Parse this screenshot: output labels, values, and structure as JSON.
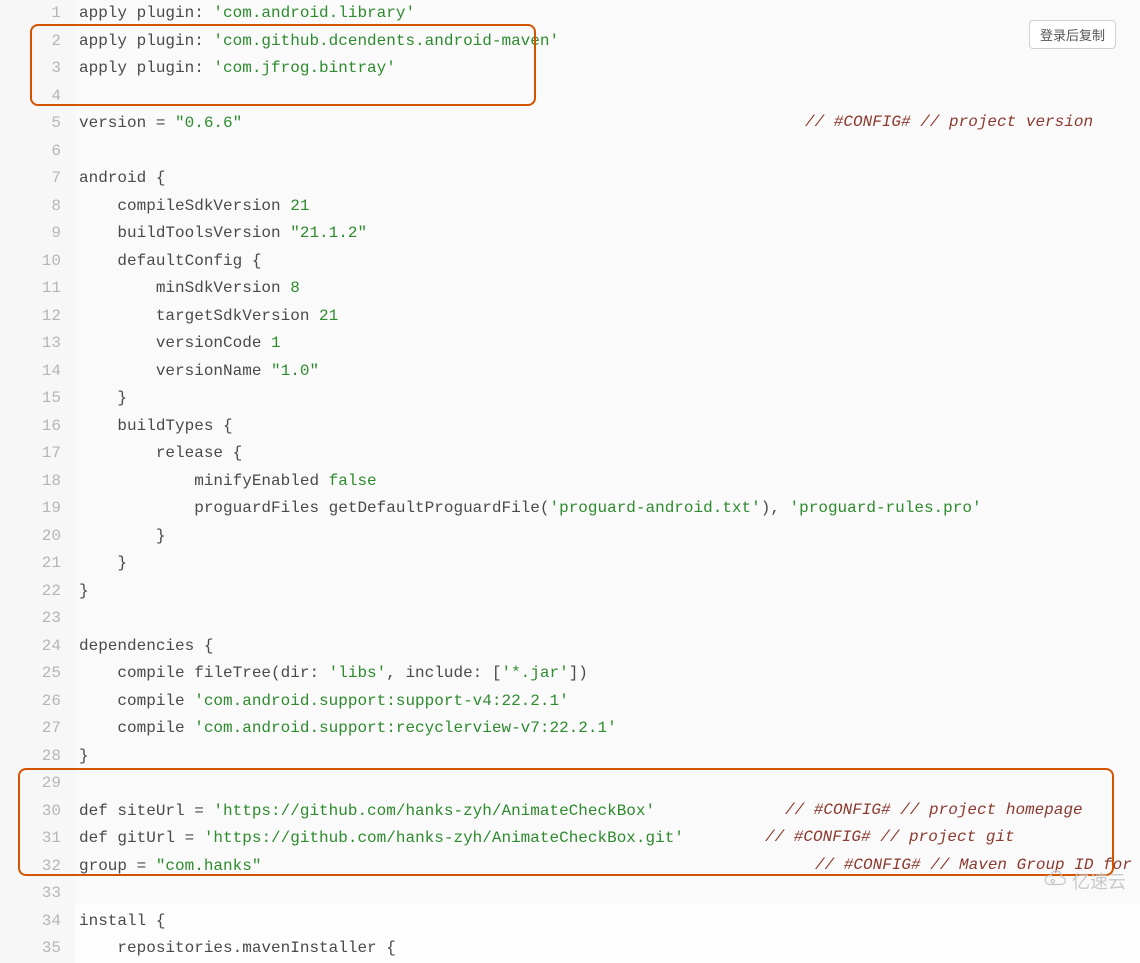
{
  "copy_button_label": "登录后复制",
  "watermark_text": "亿速云",
  "lines": [
    {
      "n": 1,
      "segs": [
        {
          "t": "apply plugin: "
        },
        {
          "t": "'com.android.library'",
          "c": "tok-str"
        }
      ]
    },
    {
      "n": 2,
      "segs": [
        {
          "t": "apply plugin: "
        },
        {
          "t": "'com.github.dcendents.android-maven'",
          "c": "tok-str"
        }
      ]
    },
    {
      "n": 3,
      "segs": [
        {
          "t": "apply plugin: "
        },
        {
          "t": "'com.jfrog.bintray'",
          "c": "tok-str"
        }
      ]
    },
    {
      "n": 4,
      "segs": [
        {
          "t": ""
        }
      ]
    },
    {
      "n": 5,
      "segs": [
        {
          "t": "version = "
        },
        {
          "t": "\"0.6.6\"",
          "c": "tok-str"
        }
      ],
      "right": "// #CONFIG# // project version"
    },
    {
      "n": 6,
      "segs": [
        {
          "t": ""
        }
      ]
    },
    {
      "n": 7,
      "segs": [
        {
          "t": "android {"
        }
      ]
    },
    {
      "n": 8,
      "segs": [
        {
          "t": "    compileSdkVersion "
        },
        {
          "t": "21",
          "c": "tok-num"
        }
      ]
    },
    {
      "n": 9,
      "segs": [
        {
          "t": "    buildToolsVersion "
        },
        {
          "t": "\"21.1.2\"",
          "c": "tok-str"
        }
      ]
    },
    {
      "n": 10,
      "segs": [
        {
          "t": "    defaultConfig {"
        }
      ]
    },
    {
      "n": 11,
      "segs": [
        {
          "t": "        minSdkVersion "
        },
        {
          "t": "8",
          "c": "tok-num"
        }
      ]
    },
    {
      "n": 12,
      "segs": [
        {
          "t": "        targetSdkVersion "
        },
        {
          "t": "21",
          "c": "tok-num"
        }
      ]
    },
    {
      "n": 13,
      "segs": [
        {
          "t": "        versionCode "
        },
        {
          "t": "1",
          "c": "tok-num"
        }
      ]
    },
    {
      "n": 14,
      "segs": [
        {
          "t": "        versionName "
        },
        {
          "t": "\"1.0\"",
          "c": "tok-str"
        }
      ]
    },
    {
      "n": 15,
      "segs": [
        {
          "t": "    }"
        }
      ]
    },
    {
      "n": 16,
      "segs": [
        {
          "t": "    buildTypes {"
        }
      ]
    },
    {
      "n": 17,
      "segs": [
        {
          "t": "        release {"
        }
      ]
    },
    {
      "n": 18,
      "segs": [
        {
          "t": "            minifyEnabled "
        },
        {
          "t": "false",
          "c": "tok-bool"
        }
      ]
    },
    {
      "n": 19,
      "segs": [
        {
          "t": "            proguardFiles getDefaultProguardFile("
        },
        {
          "t": "'proguard-android.txt'",
          "c": "tok-str"
        },
        {
          "t": "), "
        },
        {
          "t": "'proguard-rules.pro'",
          "c": "tok-str"
        }
      ]
    },
    {
      "n": 20,
      "segs": [
        {
          "t": "        }"
        }
      ]
    },
    {
      "n": 21,
      "segs": [
        {
          "t": "    }"
        }
      ]
    },
    {
      "n": 22,
      "segs": [
        {
          "t": "}"
        }
      ]
    },
    {
      "n": 23,
      "segs": [
        {
          "t": ""
        }
      ]
    },
    {
      "n": 24,
      "segs": [
        {
          "t": "dependencies {"
        }
      ]
    },
    {
      "n": 25,
      "segs": [
        {
          "t": "    compile fileTree(dir: "
        },
        {
          "t": "'libs'",
          "c": "tok-str"
        },
        {
          "t": ", include: ["
        },
        {
          "t": "'*.jar'",
          "c": "tok-str"
        },
        {
          "t": "])"
        }
      ]
    },
    {
      "n": 26,
      "segs": [
        {
          "t": "    compile "
        },
        {
          "t": "'com.android.support:support-v4:22.2.1'",
          "c": "tok-str"
        }
      ]
    },
    {
      "n": 27,
      "segs": [
        {
          "t": "    compile "
        },
        {
          "t": "'com.android.support:recyclerview-v7:22.2.1'",
          "c": "tok-str"
        }
      ]
    },
    {
      "n": 28,
      "segs": [
        {
          "t": "}"
        }
      ]
    },
    {
      "n": 29,
      "segs": [
        {
          "t": ""
        }
      ]
    },
    {
      "n": 30,
      "segs": [
        {
          "t": "def siteUrl = "
        },
        {
          "t": "'https://github.com/hanks-zyh/AnimateCheckBox'",
          "c": "tok-str"
        }
      ],
      "right": "// #CONFIG# // project homepage"
    },
    {
      "n": 31,
      "segs": [
        {
          "t": "def gitUrl = "
        },
        {
          "t": "'https://github.com/hanks-zyh/AnimateCheckBox.git'",
          "c": "tok-str"
        }
      ],
      "right": "// #CONFIG# // project git"
    },
    {
      "n": 32,
      "segs": [
        {
          "t": "group = "
        },
        {
          "t": "\"com.hanks\"",
          "c": "tok-str"
        }
      ],
      "right": "// #CONFIG# // Maven Group ID for"
    },
    {
      "n": 33,
      "segs": [
        {
          "t": ""
        }
      ]
    },
    {
      "n": 34,
      "segs": [
        {
          "t": "install {"
        }
      ]
    },
    {
      "n": 35,
      "segs": [
        {
          "t": "    repositories.mavenInstaller {"
        }
      ]
    }
  ],
  "right_comment_columns": {
    "5": 730,
    "30": 710,
    "31": 690,
    "32": 740
  }
}
